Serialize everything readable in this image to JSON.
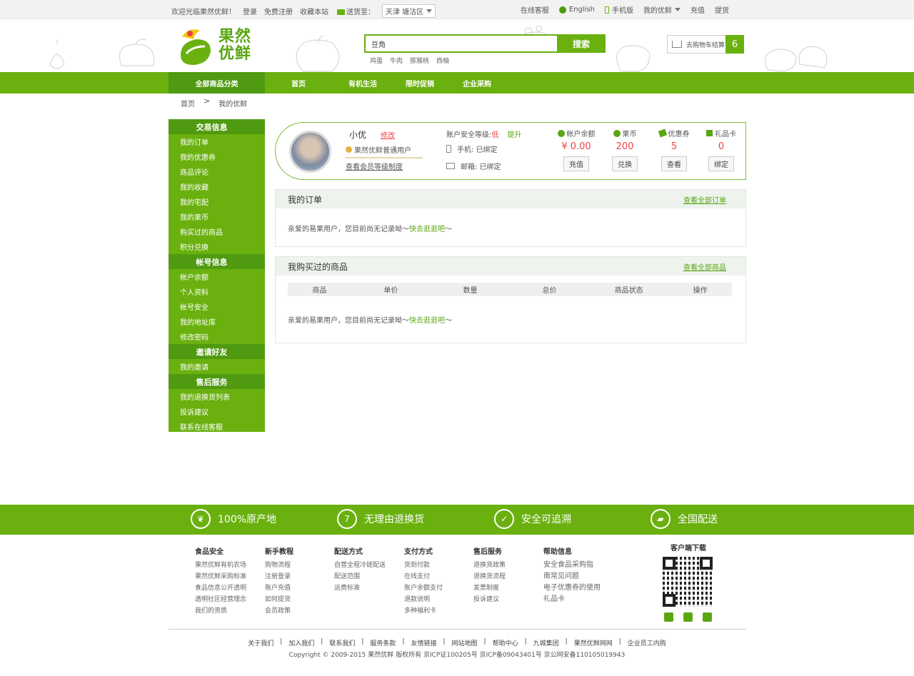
{
  "topbar": {
    "welcome": "欢迎光临果然优鲜！",
    "login": "登录",
    "register": "免费注册",
    "bookmark": "收藏本站",
    "deliver_label": "送货至：",
    "city": "天津 塘沽区",
    "service": "在线客服",
    "english": "English",
    "mobile": "手机版",
    "my_account": "我的优鲜",
    "recharge": "充值",
    "pickup": "提货"
  },
  "header": {
    "logo_text_line1": "果然",
    "logo_text_line2": "优鲜",
    "search_value": "豆角",
    "search_button": "搜索",
    "hot_words": [
      "鸡蛋",
      "牛肉",
      "猕猴桃",
      "西柚"
    ],
    "cart_label": "去购物车结算",
    "cart_count": "6"
  },
  "nav": {
    "all_categories": "全部商品分类",
    "items": [
      "首页",
      "有机生活",
      "限时促销",
      "企业采购"
    ]
  },
  "breadcrumb": {
    "home": "首页",
    "sep": ">",
    "current": "我的优鲜"
  },
  "sidebar": {
    "sections": [
      {
        "title": "交易信息",
        "items": [
          "我的订单",
          "我的优惠券",
          "商品评论",
          "我的收藏",
          "我的宅配",
          "我的果币",
          "购买过的商品",
          "积分兑换"
        ]
      },
      {
        "title": "帐号信息",
        "items": [
          "帐户余额",
          "个人资料",
          "帐号安全",
          "我的地址库",
          "修改密码"
        ]
      },
      {
        "title": "邀请好友",
        "items": [
          "我的邀请"
        ]
      },
      {
        "title": "售后服务",
        "items": [
          "我的退换货列表",
          "投诉建议",
          "联系在线客服"
        ]
      }
    ]
  },
  "profile": {
    "username": "小优",
    "edit": "修改",
    "level": "果然优鲜普通用户",
    "level_link": "查看会员等级制度",
    "security_label": "账户安全等级:",
    "security_value": "低",
    "security_upgrade": "提升",
    "phone": "手机: 已绑定",
    "email": "邮箱: 已绑定",
    "stats": [
      {
        "title": "帐户余额",
        "value": "¥ 0.00",
        "button": "充值",
        "icon": "yen-icon"
      },
      {
        "title": "果币",
        "value": "200",
        "button": "兑换",
        "icon": "coin-icon"
      },
      {
        "title": "优惠券",
        "value": "5",
        "button": "查看",
        "icon": "coupon-icon"
      },
      {
        "title": "礼品卡",
        "value": "0",
        "button": "绑定",
        "icon": "gift-icon"
      }
    ]
  },
  "orders": {
    "title": "我的订单",
    "more": "查看全部订单",
    "empty": "亲爱的易果用户，您目前尚无记录呦～",
    "empty_link": "快去逛逛吧",
    "empty_tail": "～"
  },
  "bought": {
    "title": "我购买过的商品",
    "more": "查看全部商品",
    "columns": [
      "商品",
      "单价",
      "数量",
      "总价",
      "商品状态",
      "操作"
    ],
    "empty": "亲爱的易果用户，您目前尚无记录呦～",
    "empty_link": "快去逛逛吧",
    "empty_tail": "～"
  },
  "features": [
    "100%原产地",
    "无理由退换货",
    "安全可追溯",
    "全国配送"
  ],
  "footer": {
    "columns": [
      {
        "title": "食品安全",
        "items": [
          "果然优鲜有机农场",
          "果然优鲜采购标准",
          "食品信息公开透明",
          "透明社区经营理念",
          "我们的资质"
        ]
      },
      {
        "title": "新手教程",
        "items": [
          "购物流程",
          "注册登录",
          "账户充值",
          "如何提货",
          "会员政策"
        ]
      },
      {
        "title": "配送方式",
        "items": [
          "自营全程冷链配送",
          "配送范围",
          "运费标准"
        ]
      },
      {
        "title": "支付方式",
        "items": [
          "货到付款",
          "在线支付",
          "账户余额支付",
          "退款说明",
          "多种福利卡"
        ]
      },
      {
        "title": "售后服务",
        "items": [
          "退换货政策",
          "退换货流程",
          "发票制度",
          "投诉建议"
        ]
      },
      {
        "title": "帮助信息",
        "items": [
          "安全食品采购指",
          "南常见问题",
          "电子优惠券的使用",
          "礼品卡"
        ]
      }
    ],
    "app_download": "客户端下载",
    "links": [
      "关于我们",
      "|",
      "加入我们",
      "|",
      "联系我们",
      "|",
      "服务条款",
      "|",
      "友情链接",
      "|",
      "网站地图",
      "|",
      "帮助中心",
      "|",
      "九城集团",
      "|",
      "果然优鲜网网",
      "|",
      "企业员工内购"
    ],
    "copyright": "Copyright © 2009-2015 果然优鲜 版权所有 京ICP证100205号 京ICP备09043401号 京公网安备110105019943"
  },
  "colors": {
    "brand": "#6ab10f",
    "brand_dark": "#4f9a10",
    "accent_red": "#e44"
  }
}
